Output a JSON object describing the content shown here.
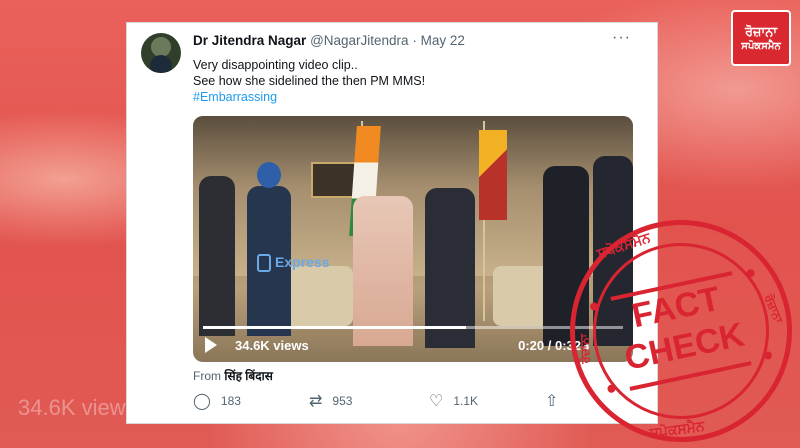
{
  "tweet": {
    "display_name": "Dr Jitendra Nagar",
    "handle": "@NagarJitendra",
    "date": "· May 22",
    "more": "···",
    "lines": [
      "Very disappointing video clip..",
      "See how she sidelined the then PM MMS!"
    ],
    "hashtag": "#Embarrassing",
    "source_prefix": "From",
    "source_name": "सिंह बिंदास"
  },
  "video": {
    "watermark": "Express",
    "views": "34.6K views",
    "time": "0:20 / 0:32",
    "progress": 0.625
  },
  "actions": {
    "replies": "183",
    "retweets": "953",
    "likes": "1.1K"
  },
  "brand": {
    "line1": "ਰੋਜ਼ਾਨਾ",
    "line2": "ਸਪੋਕਸਮੈਨ"
  },
  "stamp": {
    "top": "ਸਪੋਕਸਮੈਨ",
    "bottom": "ਸਪੋਕਸਮੈਨ",
    "left": "ਰੋਜ਼ਾਨਾ",
    "right": "ਰੋਜ਼ਾਨਾ",
    "center_line1": "FACT",
    "center_line2": "CHECK"
  },
  "background_text": "34.6K views",
  "colors": {
    "accent": "#1d9bf0",
    "stamp": "#d92432",
    "background": "#e04a45"
  }
}
